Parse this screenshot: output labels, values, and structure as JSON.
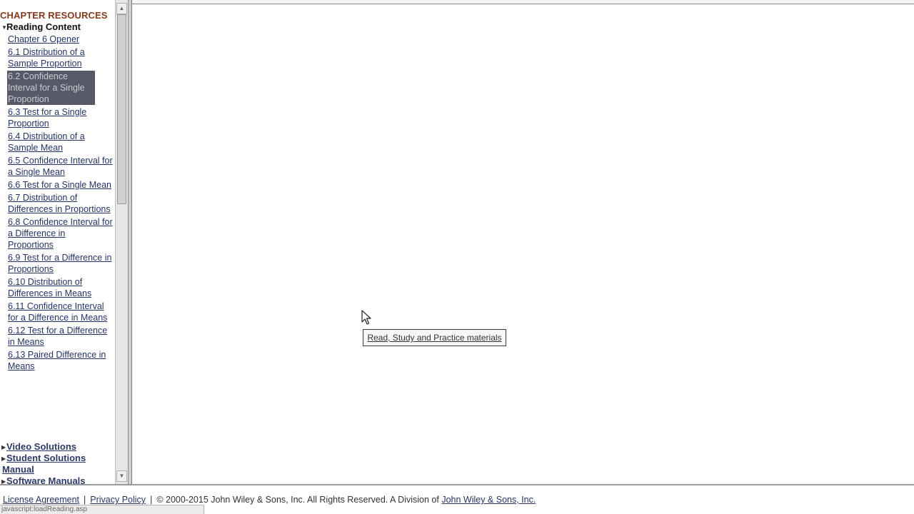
{
  "sidebar": {
    "heading": "CHAPTER RESOURCES",
    "sections": {
      "reading": "Reading Content",
      "video": "Video Solutions",
      "student_1": "Student Solutions",
      "student_2": "Manual",
      "software": "Software Manuals"
    },
    "items": [
      "Chapter 6 Opener",
      "6.1 Distribution of a Sample Proportion",
      "6.2 Confidence Interval for a Single Proportion",
      "6.3 Test for a Single Proportion",
      "6.4 Distribution of a Sample Mean",
      "6.5 Confidence Interval for a Single Mean",
      "6.6 Test for a Single Mean",
      "6.7 Distribution of Differences in Proportions",
      "6.8 Confidence Interval for a Difference in Proportions",
      "6.9 Test for a Difference in Proportions",
      "6.10 Distribution of Differences in Means",
      "6.11 Confidence Interval for a Difference in Means",
      "6.12 Test for a Difference in Means",
      "6.13 Paired Difference in Means"
    ],
    "selected_index": 2
  },
  "tooltip": "Read, Study and Practice materials",
  "footer": {
    "license": "License Agreement",
    "sep1": "|",
    "privacy": "Privacy Policy",
    "sep2": "|",
    "copyright": "© 2000-2015 John Wiley & Sons, Inc. All Rights Reserved. A Division of",
    "company": "John Wiley & Sons, Inc."
  },
  "status_text": "javascript:loadReading.asp",
  "icons": {
    "expanded": "triangle-down-icon",
    "collapsed": "triangle-right-icon",
    "cursor": "arrow-cursor-icon"
  },
  "colors": {
    "heading": "#8a3a1a",
    "link": "#24346a",
    "selected_bg": "#555a66"
  }
}
